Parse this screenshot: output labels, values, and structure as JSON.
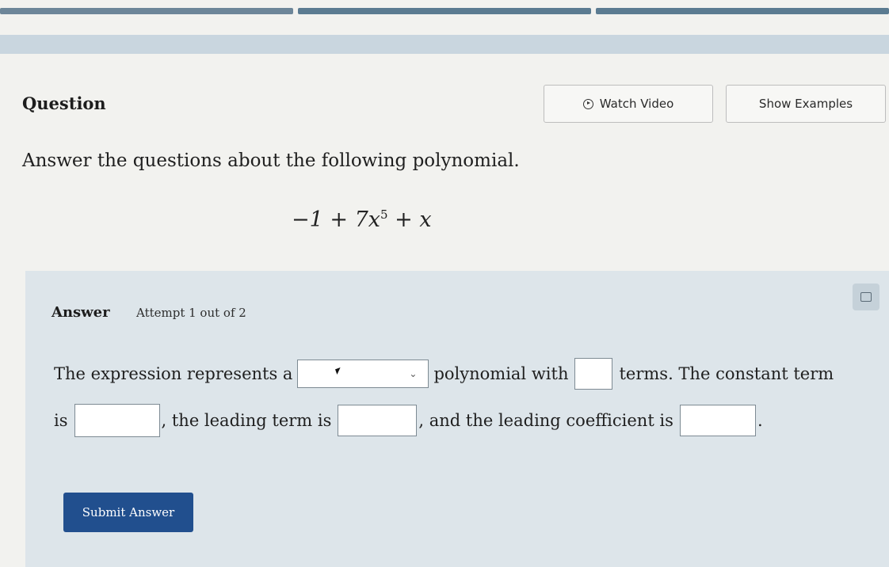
{
  "header": {
    "question_label": "Question",
    "watch_video_label": "Watch Video",
    "show_examples_label": "Show Examples",
    "icons": {
      "watch": "play-circle-icon"
    }
  },
  "question": {
    "instructions": "Answer the questions about the following polynomial.",
    "polynomial": {
      "term1": "−1 + 7x",
      "exponent": "5",
      "term2": " + x"
    }
  },
  "answer": {
    "label": "Answer",
    "attempt": "Attempt 1 out of 2",
    "sentence": {
      "p1": "The expression represents a",
      "p2": "polynomial with",
      "p3": "terms. The constant term",
      "p4": "is",
      "p5": ", the leading term is",
      "p6": ", and the leading coefficient is",
      "p7": "."
    },
    "select": {
      "value": "",
      "chevron": "⌄"
    },
    "inputs": {
      "terms": "",
      "constant_term": "",
      "leading_term": "",
      "leading_coefficient": ""
    },
    "submit_label": "Submit Answer",
    "icons": {
      "calculator": "calculator-icon"
    }
  },
  "colors": {
    "primary_button": "#214f8e",
    "panel_bg": "#dde5ea",
    "progress": "#5b7b91"
  }
}
